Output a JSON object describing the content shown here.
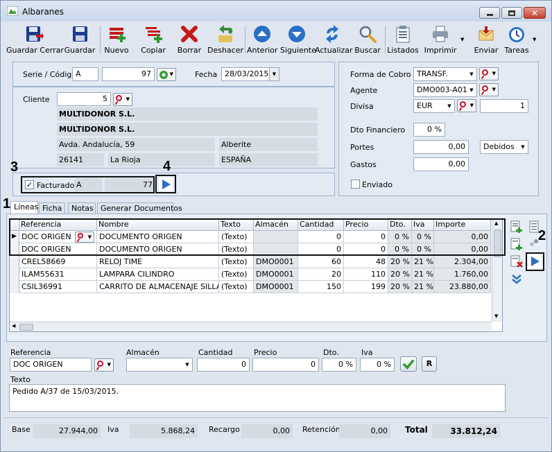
{
  "window": {
    "title": "Albaranes"
  },
  "toolbar": {
    "items": [
      {
        "label": "Guardar Cerrar",
        "icon": "save-close-icon"
      },
      {
        "label": "Guardar",
        "icon": "save-icon"
      },
      {
        "label": "Nuevo",
        "icon": "new-icon"
      },
      {
        "label": "Copiar",
        "icon": "copy-icon"
      },
      {
        "label": "Borrar",
        "icon": "delete-icon"
      },
      {
        "label": "Deshacer",
        "icon": "undo-icon"
      },
      {
        "label": "Anterior",
        "icon": "previous-icon"
      },
      {
        "label": "Siguiente",
        "icon": "next-icon"
      },
      {
        "label": "Actualizar",
        "icon": "refresh-icon"
      },
      {
        "label": "Buscar",
        "icon": "search-icon"
      },
      {
        "label": "Listados",
        "icon": "reports-icon"
      },
      {
        "label": "Imprimir",
        "icon": "print-icon"
      },
      {
        "label": "Enviar",
        "icon": "send-icon"
      },
      {
        "label": "Tareas",
        "icon": "tasks-icon"
      }
    ]
  },
  "header": {
    "serie_label": "Serie / Código",
    "serie": "A",
    "codigo": "97",
    "fecha_label": "Fecha",
    "fecha": "28/03/2015",
    "cliente_label": "Cliente",
    "cliente_id": "5",
    "cliente_nombre": "MULTIDONOR S.L.",
    "cliente_razon": "MULTIDONOR S.L.",
    "direccion": "Avda. Andalucía, 59",
    "localidad": "Alberite",
    "cp": "26141",
    "provincia": "La Rioja",
    "pais": "ESPAÑA",
    "facturado_label": "Facturado",
    "factura_serie": "A",
    "factura_num": "77"
  },
  "right": {
    "forma_cobro_label": "Forma de Cobro",
    "forma_cobro": "TRANSF.",
    "agente_label": "Agente",
    "agente": "DMO003-A01",
    "divisa_label": "Divisa",
    "divisa": "EUR",
    "divisa_cambio": "1",
    "dto_fin_label": "Dto Financiero",
    "dto_fin": "0 %",
    "portes_label": "Portes",
    "portes": "0,00",
    "portes_tipo": "Debidos",
    "gastos_label": "Gastos",
    "gastos": "0,00",
    "enviado_label": "Enviado"
  },
  "callouts": [
    "1",
    "2",
    "3",
    "4"
  ],
  "tabs": [
    "Líneas",
    "Ficha",
    "Notas",
    "Generar Documentos"
  ],
  "grid": {
    "columns": [
      "Referencia",
      "Nombre",
      "Texto",
      "Almacén",
      "Cantidad",
      "Precio",
      "Dto.",
      "Iva",
      "Importe"
    ],
    "rows": [
      [
        "DOC ORIGEN",
        "DOCUMENTO ORIGEN",
        "(Texto)",
        "",
        "0",
        "0",
        "0 %",
        "0 %",
        "0,00"
      ],
      [
        "DOC ORIGEN",
        "DOCUMENTO ORIGEN",
        "(Texto)",
        "",
        "0",
        "0",
        "0 %",
        "0 %",
        "0,00"
      ],
      [
        "CREL58669",
        "RELOJ TIME",
        "(Texto)",
        "DMO0001",
        "60",
        "48",
        "20 %",
        "21 %",
        "2.304,00"
      ],
      [
        "ILAM55631",
        "LAMPARA CILINDRO",
        "(Texto)",
        "DMO0001",
        "20",
        "110",
        "20 %",
        "21 %",
        "1.760,00"
      ],
      [
        "CSIL36991",
        "CARRITO DE ALMACENAJE SILLA",
        "(Texto)",
        "DMO0001",
        "150",
        "199",
        "20 %",
        "21 %",
        "23.880,00"
      ]
    ]
  },
  "editor": {
    "referencia_label": "Referencia",
    "referencia": "DOC ORIGEN",
    "almacen_label": "Almacén",
    "almacen": "",
    "cantidad_label": "Cantidad",
    "cantidad": "0",
    "precio_label": "Precio",
    "precio": "0",
    "dto_label": "Dto.",
    "dto": "0 %",
    "iva_label": "Iva",
    "iva": "0 %",
    "texto_label": "Texto",
    "texto": "Pedido A/37 de 15/03/2015.",
    "r_button": "R"
  },
  "totals": {
    "base_label": "Base",
    "base": "27.944,00",
    "iva_label": "Iva",
    "iva": "5.868,24",
    "recargo_label": "Recargo",
    "recargo": "0,00",
    "retencion_label": "Retención",
    "retencion": "0,00",
    "total_label": "Total",
    "total": "33.812,24"
  },
  "colors": {
    "accent": "#2b6fc4",
    "save": "#1c3d8c",
    "delete": "#c41919",
    "ok": "#2f9a2f",
    "callout_border": "#111111"
  }
}
